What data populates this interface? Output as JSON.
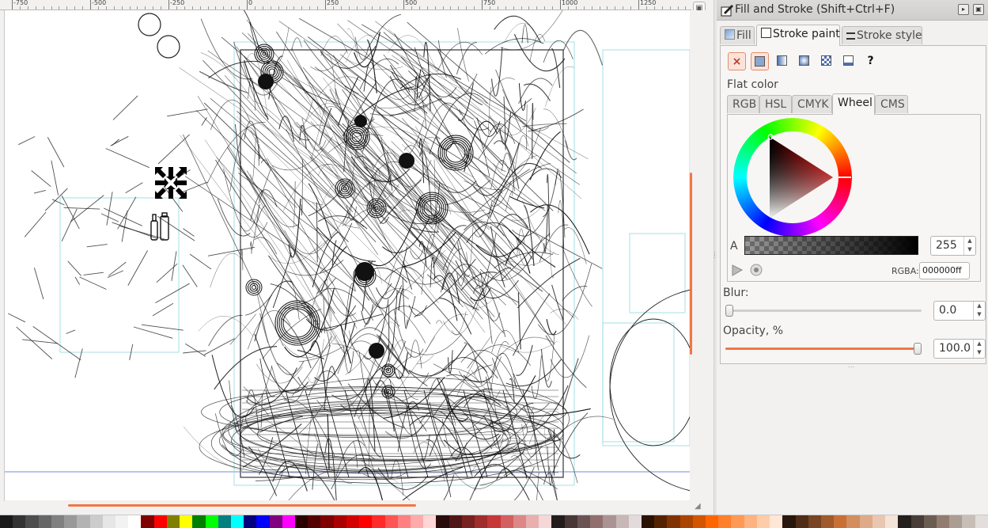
{
  "ruler": {
    "labels": [
      "-750",
      "-500",
      "-250",
      "0",
      "250",
      "500",
      "750",
      "1000",
      "1250"
    ]
  },
  "dialog": {
    "title": "Fill and Stroke (Shift+Ctrl+F)",
    "tabs": [
      {
        "label": "Fill",
        "active": false
      },
      {
        "label": "Stroke paint",
        "active": true
      },
      {
        "label": "Stroke style",
        "active": false
      }
    ],
    "paint_modes": [
      "no-paint",
      "flat-color",
      "linear-gradient",
      "radial-gradient",
      "pattern",
      "swatch",
      "unset"
    ],
    "unset_glyph": "?",
    "no_paint_glyph": "×",
    "paint_type_label": "Flat color",
    "color_tabs": [
      {
        "label": "RGB",
        "active": false
      },
      {
        "label": "HSL",
        "active": false
      },
      {
        "label": "CMYK",
        "active": false
      },
      {
        "label": "Wheel",
        "active": true
      },
      {
        "label": "CMS",
        "active": false
      }
    ],
    "alpha_label": "A",
    "alpha_value": "255",
    "rgba_label": "RGBA:",
    "rgba_value": "000000ff",
    "blur_label": "Blur:",
    "blur_value": "0.0",
    "blur_fraction": 0.0,
    "opacity_label": "Opacity, %",
    "opacity_value": "100.0",
    "opacity_fraction": 1.0
  },
  "colors": {
    "accent": "#f07746",
    "selected_stroke": "#000000"
  },
  "palette": [
    "#1a1a1a",
    "#333333",
    "#4d4d4d",
    "#666666",
    "#808080",
    "#999999",
    "#b3b3b3",
    "#cccccc",
    "#e6e6e6",
    "#f2f2f2",
    "#ffffff",
    "#800000",
    "#ff0000",
    "#808000",
    "#ffff00",
    "#008000",
    "#00ff00",
    "#008080",
    "#00ffff",
    "#000080",
    "#0000ff",
    "#800080",
    "#ff00ff",
    "#2b0000",
    "#550000",
    "#800000",
    "#aa0000",
    "#d40000",
    "#ff0000",
    "#ff2a2a",
    "#ff5555",
    "#ff8080",
    "#ffaaaa",
    "#ffd5d5",
    "#280b0b",
    "#501616",
    "#782121",
    "#a02c2c",
    "#c83737",
    "#d35f5f",
    "#de8787",
    "#e9afaf",
    "#f4d7d7",
    "#241c1c",
    "#483737",
    "#6c5353",
    "#916f6f",
    "#ac9393",
    "#c8b7b7",
    "#e3dbdb",
    "#2b1100",
    "#552200",
    "#803300",
    "#aa4400",
    "#d45500",
    "#ff6600",
    "#ff7f2a",
    "#ff9955",
    "#ffb380",
    "#ffccaa",
    "#ffe6d5",
    "#28170b",
    "#502d16",
    "#784421",
    "#a05a2c",
    "#c87137",
    "#d38d5f",
    "#deaa87",
    "#e9c6af",
    "#f4e3d7",
    "#241f1c",
    "#483e37",
    "#6c5d53",
    "#917c6f",
    "#ac9d93",
    "#c8beb7",
    "#e3dedb"
  ]
}
